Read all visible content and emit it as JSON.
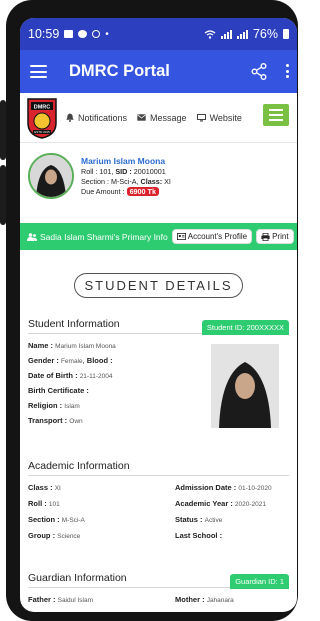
{
  "status_bar": {
    "time": "10:59",
    "dot": "•",
    "battery": "76%"
  },
  "app_bar": {
    "title": "DMRC Portal"
  },
  "top_nav": {
    "logo_text_top": "DMRC",
    "logo_text_bottom": "ESTD 2015",
    "links": [
      "Notifications",
      "Message",
      "Website"
    ]
  },
  "profile": {
    "name": "Marium Islam Moona",
    "roll_label": "Roll :",
    "roll": "101",
    "sid_label": "SID :",
    "sid": "20010001",
    "section_label": "Section :",
    "section": "M-Sci-A",
    "class_label": "Class:",
    "class": "XI",
    "due_label": "Due Amount :",
    "due": "6900 Tk"
  },
  "info_bar": {
    "title": "Sadia Islam Sharmi's Primary Info",
    "account_button": "Account's Profile",
    "print_button": "Print"
  },
  "page_title": "STUDENT DETAILS",
  "student_info": {
    "heading": "Student Information",
    "badge": "Student ID: 200XXXXX",
    "name_label": "Name :",
    "name": "Marium Islam Moona",
    "gender_label": "Gender :",
    "gender": "Female",
    "blood_label": "Blood :",
    "blood": "",
    "dob_label": "Date of Birth :",
    "dob": "21-11-2004",
    "birth_cert_label": "Birth Certificate :",
    "birth_cert": "",
    "religion_label": "Religion :",
    "religion": "Islam",
    "transport_label": "Transport :",
    "transport": "Own"
  },
  "academic_info": {
    "heading": "Academic Information",
    "class_label": "Class :",
    "class": "XI",
    "roll_label": "Roll :",
    "roll": "101",
    "section_label": "Section :",
    "section": "M-Sci-A",
    "group_label": "Group :",
    "group": "Science",
    "admission_label": "Admission Date :",
    "admission": "01-10-2020",
    "year_label": "Academic Year :",
    "year": "2020-2021",
    "status_label": "Status :",
    "status": "Active",
    "last_school_label": "Last School :",
    "last_school": ""
  },
  "guardian_info": {
    "heading": "Guardian Information",
    "badge": "Guardian ID: 1",
    "father_label": "Father :",
    "father": "Saidul Islam",
    "mother_label": "Mother :",
    "mother": "Jahanara"
  },
  "colors": {
    "status": "#2b3fbf",
    "appbar": "#3555e0",
    "green": "#2ecc71",
    "menu_green": "#7ac143",
    "due_red": "#d9232d"
  }
}
